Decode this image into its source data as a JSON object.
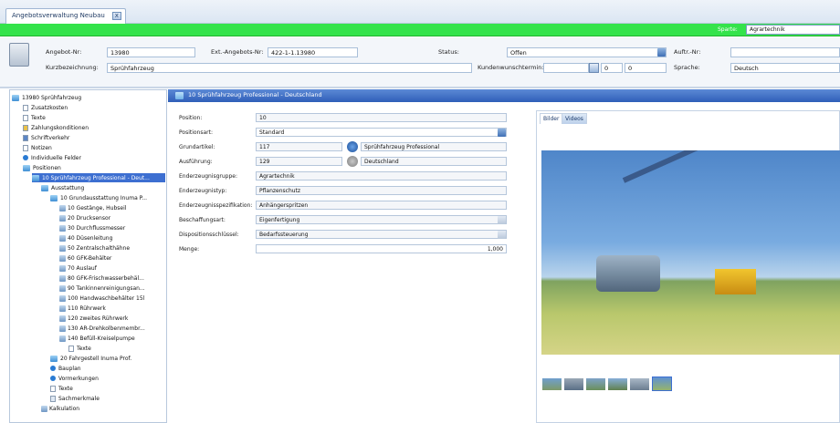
{
  "window": {
    "tab_title": "Angebotsverwaltung Neubau",
    "close_label": "x"
  },
  "sparte": {
    "label": "Sparte:",
    "value": "Agrartechnik"
  },
  "header": {
    "angebot_nr_label": "Angebot-Nr:",
    "angebot_nr": "13980",
    "ext_label": "Ext.-Angebots-Nr:",
    "ext_value": "422-1-1.13980",
    "status_label": "Status:",
    "status_value": "Offen",
    "auftr_label": "Auftr.-Nr:",
    "auftr_value": "",
    "kurz_label": "Kurzbezeichnung:",
    "kurz_value": "Sprühfahrzeug",
    "kunden_label": "Kundenwunschtermin:",
    "kunden_date": "",
    "kunden_a": "0",
    "kunden_b": "0",
    "sprache_label": "Sprache:",
    "sprache_value": "Deutsch"
  },
  "tree": [
    "13980 Sprühfahrzeug",
    "Zusatzkosten",
    "Texte",
    "Zahlungskonditionen",
    "Schriftverkehr",
    "Notizen",
    "Individuelle Felder",
    "Positionen",
    "10 Sprühfahrzeug Professional - Deut...",
    "Ausstattung",
    "10 Grundausstattung Inuma P...",
    "10 Gestänge, Hubseil",
    "20 Drucksensor",
    "30 Durchflussmesser",
    "40 Düsenleitung",
    "50 Zentralschalthähne",
    "60 GFK-Behälter",
    "70 Auslauf",
    "80 GFK-Frischwasserbehäl...",
    "90 Tankinnenreinigungsan...",
    "100 Handwaschbehälter 15l",
    "110 Rührwerk",
    "120 zweites Rührwerk",
    "130 AR-Drehkolbenmembr...",
    "140 Befüll-Kreiselpumpe",
    "Texte",
    "20 Fahrgestell Inuma Prof.",
    "Bauplan",
    "Vormerkungen",
    "Texte",
    "Sachmerkmale",
    "Kalkulation"
  ],
  "main": {
    "title": "10 Sprühfahrzeug Professional - Deutschland",
    "fields": [
      {
        "label": "Position:",
        "value": "10"
      },
      {
        "label": "Positionsart:",
        "value": "Standard"
      },
      {
        "label": "Grundartikel:",
        "value": "117",
        "extra": "Sprühfahrzeug Professional"
      },
      {
        "label": "Ausführung:",
        "value": "129",
        "extra": "Deutschland"
      },
      {
        "label": "Enderzeugnisgruppe:",
        "value": "Agrartechnik"
      },
      {
        "label": "Enderzeugnistyp:",
        "value": "Pflanzenschutz"
      },
      {
        "label": "Enderzeugnisspezifikation:",
        "value": "Anhängerspritzen"
      },
      {
        "label": "Beschaffungsart:",
        "value": "Eigenfertigung"
      },
      {
        "label": "Dispositionsschlüssel:",
        "value": "Bedarfssteuerung"
      },
      {
        "label": "Menge:",
        "value": "1,000"
      }
    ]
  },
  "images": {
    "tab_bilder": "Bilder",
    "tab_videos": "Videos"
  }
}
